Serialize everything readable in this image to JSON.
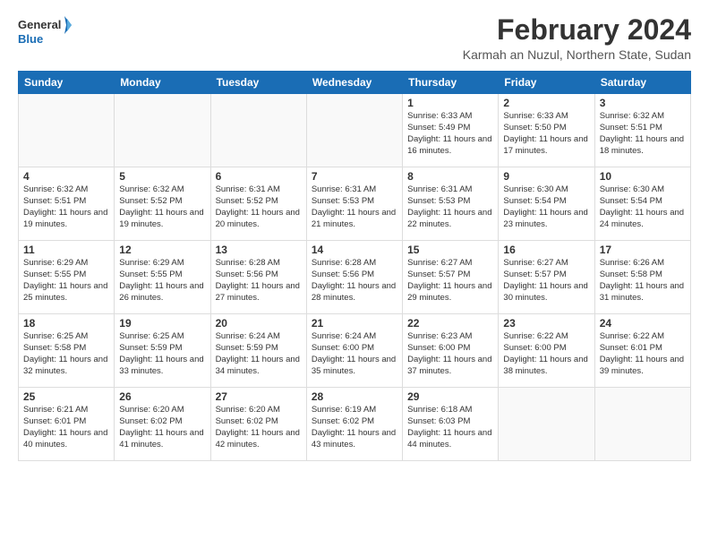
{
  "logo": {
    "line1": "General",
    "line2": "Blue"
  },
  "title": "February 2024",
  "subtitle": "Karmah an Nuzul, Northern State, Sudan",
  "weekdays": [
    "Sunday",
    "Monday",
    "Tuesday",
    "Wednesday",
    "Thursday",
    "Friday",
    "Saturday"
  ],
  "weeks": [
    [
      {
        "day": "",
        "info": ""
      },
      {
        "day": "",
        "info": ""
      },
      {
        "day": "",
        "info": ""
      },
      {
        "day": "",
        "info": ""
      },
      {
        "day": "1",
        "info": "Sunrise: 6:33 AM\nSunset: 5:49 PM\nDaylight: 11 hours and 16 minutes."
      },
      {
        "day": "2",
        "info": "Sunrise: 6:33 AM\nSunset: 5:50 PM\nDaylight: 11 hours and 17 minutes."
      },
      {
        "day": "3",
        "info": "Sunrise: 6:32 AM\nSunset: 5:51 PM\nDaylight: 11 hours and 18 minutes."
      }
    ],
    [
      {
        "day": "4",
        "info": "Sunrise: 6:32 AM\nSunset: 5:51 PM\nDaylight: 11 hours and 19 minutes."
      },
      {
        "day": "5",
        "info": "Sunrise: 6:32 AM\nSunset: 5:52 PM\nDaylight: 11 hours and 19 minutes."
      },
      {
        "day": "6",
        "info": "Sunrise: 6:31 AM\nSunset: 5:52 PM\nDaylight: 11 hours and 20 minutes."
      },
      {
        "day": "7",
        "info": "Sunrise: 6:31 AM\nSunset: 5:53 PM\nDaylight: 11 hours and 21 minutes."
      },
      {
        "day": "8",
        "info": "Sunrise: 6:31 AM\nSunset: 5:53 PM\nDaylight: 11 hours and 22 minutes."
      },
      {
        "day": "9",
        "info": "Sunrise: 6:30 AM\nSunset: 5:54 PM\nDaylight: 11 hours and 23 minutes."
      },
      {
        "day": "10",
        "info": "Sunrise: 6:30 AM\nSunset: 5:54 PM\nDaylight: 11 hours and 24 minutes."
      }
    ],
    [
      {
        "day": "11",
        "info": "Sunrise: 6:29 AM\nSunset: 5:55 PM\nDaylight: 11 hours and 25 minutes."
      },
      {
        "day": "12",
        "info": "Sunrise: 6:29 AM\nSunset: 5:55 PM\nDaylight: 11 hours and 26 minutes."
      },
      {
        "day": "13",
        "info": "Sunrise: 6:28 AM\nSunset: 5:56 PM\nDaylight: 11 hours and 27 minutes."
      },
      {
        "day": "14",
        "info": "Sunrise: 6:28 AM\nSunset: 5:56 PM\nDaylight: 11 hours and 28 minutes."
      },
      {
        "day": "15",
        "info": "Sunrise: 6:27 AM\nSunset: 5:57 PM\nDaylight: 11 hours and 29 minutes."
      },
      {
        "day": "16",
        "info": "Sunrise: 6:27 AM\nSunset: 5:57 PM\nDaylight: 11 hours and 30 minutes."
      },
      {
        "day": "17",
        "info": "Sunrise: 6:26 AM\nSunset: 5:58 PM\nDaylight: 11 hours and 31 minutes."
      }
    ],
    [
      {
        "day": "18",
        "info": "Sunrise: 6:25 AM\nSunset: 5:58 PM\nDaylight: 11 hours and 32 minutes."
      },
      {
        "day": "19",
        "info": "Sunrise: 6:25 AM\nSunset: 5:59 PM\nDaylight: 11 hours and 33 minutes."
      },
      {
        "day": "20",
        "info": "Sunrise: 6:24 AM\nSunset: 5:59 PM\nDaylight: 11 hours and 34 minutes."
      },
      {
        "day": "21",
        "info": "Sunrise: 6:24 AM\nSunset: 6:00 PM\nDaylight: 11 hours and 35 minutes."
      },
      {
        "day": "22",
        "info": "Sunrise: 6:23 AM\nSunset: 6:00 PM\nDaylight: 11 hours and 37 minutes."
      },
      {
        "day": "23",
        "info": "Sunrise: 6:22 AM\nSunset: 6:00 PM\nDaylight: 11 hours and 38 minutes."
      },
      {
        "day": "24",
        "info": "Sunrise: 6:22 AM\nSunset: 6:01 PM\nDaylight: 11 hours and 39 minutes."
      }
    ],
    [
      {
        "day": "25",
        "info": "Sunrise: 6:21 AM\nSunset: 6:01 PM\nDaylight: 11 hours and 40 minutes."
      },
      {
        "day": "26",
        "info": "Sunrise: 6:20 AM\nSunset: 6:02 PM\nDaylight: 11 hours and 41 minutes."
      },
      {
        "day": "27",
        "info": "Sunrise: 6:20 AM\nSunset: 6:02 PM\nDaylight: 11 hours and 42 minutes."
      },
      {
        "day": "28",
        "info": "Sunrise: 6:19 AM\nSunset: 6:02 PM\nDaylight: 11 hours and 43 minutes."
      },
      {
        "day": "29",
        "info": "Sunrise: 6:18 AM\nSunset: 6:03 PM\nDaylight: 11 hours and 44 minutes."
      },
      {
        "day": "",
        "info": ""
      },
      {
        "day": "",
        "info": ""
      }
    ]
  ]
}
